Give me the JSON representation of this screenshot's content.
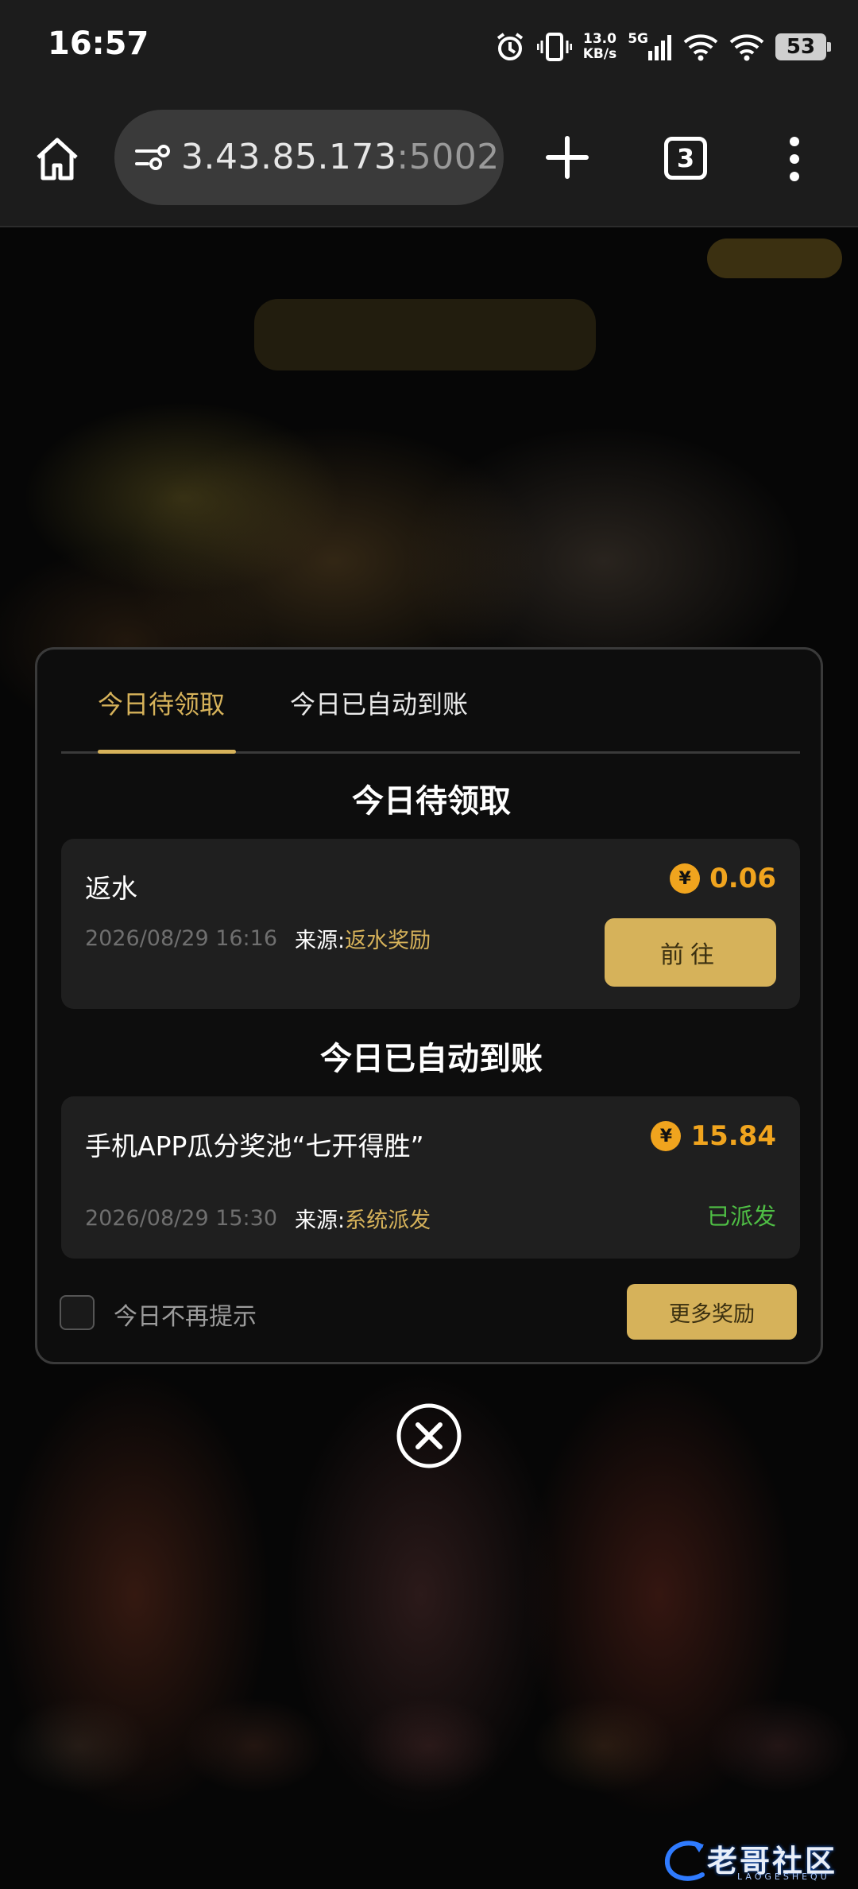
{
  "status_bar": {
    "time": "16:57",
    "net_speed_value": "13.0",
    "net_speed_unit": "KB/s",
    "network_type": "5G",
    "battery": "53"
  },
  "browser": {
    "url_host": "3.43.85.173",
    "url_port": ":5002",
    "tab_count": "3"
  },
  "dialog": {
    "tabs": [
      "今日待领取",
      "今日已自动到账"
    ],
    "active_tab": 0,
    "pending": {
      "title": "今日待领取",
      "item": {
        "name": "返水",
        "amount": "0.06",
        "date": "2026/08/29 16:16",
        "source_label": "来源:",
        "source": "返水奖励",
        "button": "前往"
      }
    },
    "auto": {
      "title": "今日已自动到账",
      "item": {
        "name": "手机APP瓜分奖池“七开得胜”",
        "amount": "15.84",
        "date": "2026/08/29 15:30",
        "source_label": "来源:",
        "source": "系统派发",
        "status": "已派发"
      }
    },
    "dont_show_today": "今日不再提示",
    "more_rewards": "更多奖励",
    "coin_symbol": "¥"
  },
  "watermark": {
    "text": "老哥社区",
    "sub": "LAOGESHEQU"
  },
  "colors": {
    "accent_gold": "#d6b25a",
    "amount_orange": "#f0a41e",
    "status_green": "#4fbf45"
  }
}
